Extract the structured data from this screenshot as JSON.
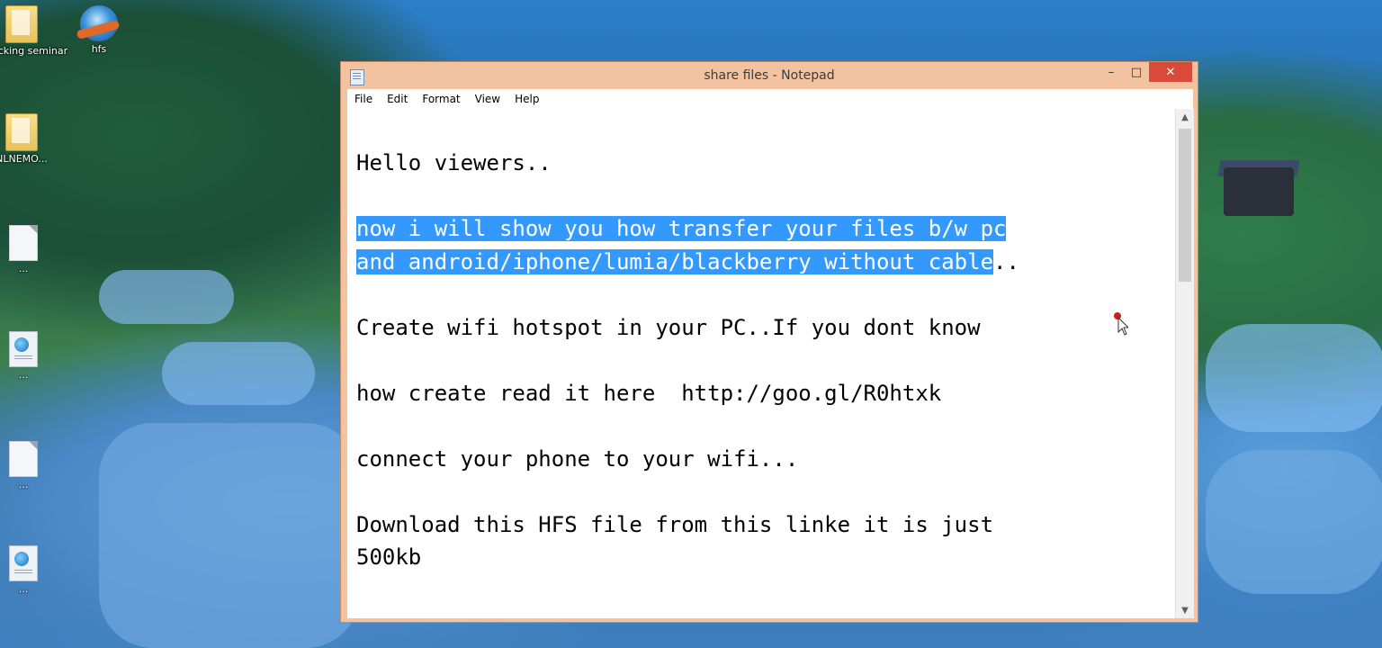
{
  "desktop": {
    "icons": [
      {
        "label": "hacking seminar",
        "kind": "folder"
      },
      {
        "label": "hfs",
        "kind": "app"
      },
      {
        "label": "NLNEMO...",
        "kind": "folder"
      },
      {
        "label": "...",
        "kind": "document"
      },
      {
        "label": "...",
        "kind": "webdoc"
      },
      {
        "label": "...",
        "kind": "document"
      },
      {
        "label": "...",
        "kind": "webdoc"
      }
    ]
  },
  "window": {
    "title": "share files - Notepad",
    "controls": {
      "minimize": "–",
      "maximize": "□",
      "close": "✕"
    },
    "menu": [
      "File",
      "Edit",
      "Format",
      "View",
      "Help"
    ]
  },
  "document": {
    "lines": [
      "",
      "Hello viewers..",
      "",
      "now i will show you how transfer your files b/w pc",
      "and android/iphone/lumia/blackberry without cable",
      "",
      "Create wifi hotspot in your PC..If you dont know",
      "",
      "how create read it here  http://goo.gl/R0htxk",
      "",
      "connect your phone to your wifi...",
      "",
      "Download this HFS file from this linke it is just",
      "500kb"
    ],
    "line4_tail": "..",
    "selection_color": "#3399ff"
  },
  "colors": {
    "titlebar": "#f3c2a0",
    "close_button": "#d94a38"
  }
}
